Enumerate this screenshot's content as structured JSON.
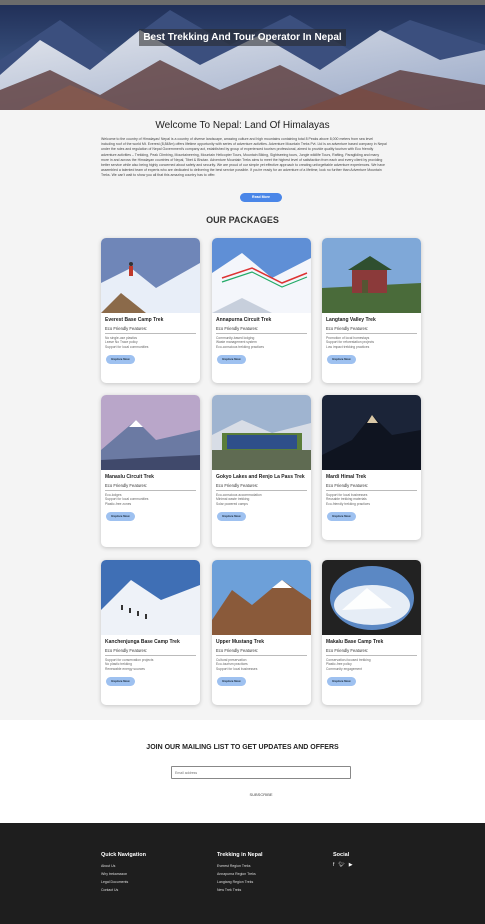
{
  "hero": {
    "title": "Best Trekking And Tour Operator In Nepal"
  },
  "welcome": {
    "title": "Welcome To Nepal: Land Of Himalayas",
    "body": "Welcome to the country of Himalayas! Nepal is a country of diverse landscape, amazing culture and high mountains containing total 8 Peaks above 8,000 meters from sea level including roof of the world Mt. Everest (8,848m) offers lifetime opportunity with series of adventure activities. Adventure Mountain Treks Pvt. Ltd is an adventure based company in Nepal under the rules and regulation of Nepal Government's company act, established by group of experienced tourism professional, aimed to provide quality tourism with Eco friendly adventure activities – Trekking, Peak Climbing, Mountaineering, Mountain Helicopter Tours, Mountain Biking, Sightseeing tours, Jungle wildlife Tours, Rafting, Paragliding and many more in and across the Himalayan countries of Nepal, Tibet & Bhutan. Adventure Mountain Treks aims to meet the highest level of satisfaction from each and every client by providing better service while also being highly concerned about safety and security. We are proud of our simple yet effective approach to creating unforgettable adventure experiences. We have assembled a talented team of experts who are dedicated to delivering the best service possible. If you're ready for an adventure of a lifetime, look no further than Adventure Mountain Treks. We can't wait to show you all that this amazing country has to offer.",
    "read_more": "Read More"
  },
  "packages": {
    "title": "OUR PACKAGES",
    "features_label": "Eco Friendly Features:",
    "explore_label": "Explore Now",
    "items": [
      {
        "name": "Everest Base Camp Trek",
        "features": [
          "No single-use plastics",
          "Leave No Trace policy",
          "Support for local communities"
        ]
      },
      {
        "name": "Annapurna Circuit Trek",
        "features": [
          "Community-based lodging",
          "Waste management system",
          "Eco-conscious trekking practices"
        ]
      },
      {
        "name": "Langtang Valley Trek",
        "features": [
          "Promotion of local homestays",
          "Support for reforestation projects",
          "Low impact trekking practices"
        ]
      },
      {
        "name": "Manaslu Circuit Trek",
        "features": [
          "Eco-lodges",
          "Support for local communities",
          "Plastic-free zones"
        ]
      },
      {
        "name": "Gokyo Lakes and Renjo La Pass Trek",
        "features": [
          "Eco-conscious accommodation",
          "Minimal waste trekking",
          "Solar powered camps"
        ]
      },
      {
        "name": "Mardi Himal Trek",
        "features": [
          "Support for local businesses",
          "Reusable trekking materials",
          "Eco-friendly trekking practices"
        ]
      },
      {
        "name": "Kanchenjunga Base Camp Trek",
        "features": [
          "Support for conservation projects",
          "No plastic trekking",
          "Renewable energy sources"
        ]
      },
      {
        "name": "Upper Mustang Trek",
        "features": [
          "Cultural preservation",
          "Eco-tourism practices",
          "Support for local businesses"
        ]
      },
      {
        "name": "Makalu Base Camp Trek",
        "features": [
          "Conservation-focused trekking",
          "Plastic-free policy",
          "Community engagement"
        ]
      }
    ]
  },
  "mailing": {
    "title": "JOIN OUR MAILING LIST TO GET UPDATES AND OFFERS",
    "placeholder": "Email address",
    "button": "SUBSCRIBE"
  },
  "footer": {
    "quick_nav": {
      "title": "Quick Navigation",
      "links": [
        "About Us",
        "Why trekamazon",
        "Legal Documents",
        "Contact Us"
      ]
    },
    "trekking": {
      "title": "Trekking in Nepal",
      "links": [
        "Everest Region Treks",
        "Annapurna Region Treks",
        "Langtang Region Treks",
        "New Trek Treks"
      ]
    },
    "social": {
      "title": "Social",
      "icons": [
        "facebook-icon",
        "twitter-icon",
        "youtube-icon"
      ]
    }
  },
  "colors": {
    "accent": "#4a86e8",
    "footer_bg": "#1e1e1e",
    "explore_btn": "#9ec1f0"
  }
}
